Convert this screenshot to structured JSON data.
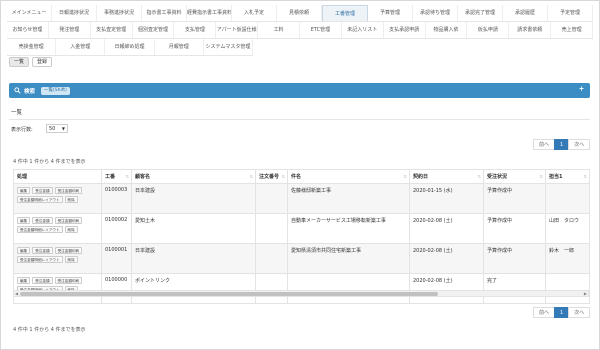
{
  "nav": {
    "row1": [
      "メインメニュー",
      "日報進捗状況",
      "事務進捗状況",
      "指示書工事資料",
      "経費指示書工事資料",
      "入札予定",
      "見積依頼",
      "工番管理",
      "予算管理",
      "承認待ち管理",
      "承認完了管理",
      "承認履歴",
      "予定管理"
    ],
    "row2": [
      "お知らせ管理",
      "発注管理",
      "支払査定管理",
      "個別査定管理",
      "支払管理",
      "アパート仮設仕様",
      "工料",
      "ETC管理",
      "未記入リスト",
      "支払承認申請",
      "物品購入依",
      "仮払申請",
      "請求書依頼",
      "売上管理"
    ],
    "row3": [
      "売掛金管理",
      "入金管理",
      "日報締め処理",
      "月報管理",
      "システムマスタ管理"
    ],
    "active": "工番管理"
  },
  "subtabs": [
    "一覧",
    "登録"
  ],
  "search": {
    "label": "検索",
    "button": "一覧(Shift)"
  },
  "list": {
    "title": "一覧",
    "perpage_label": "表示行数:",
    "perpage_value": "50",
    "info_top": "4 件中 1 件から 4 件までを表示",
    "info_bottom": "4 件中 1 件から 4 件までを表示"
  },
  "pager": {
    "prev": "前へ",
    "current": "1",
    "next": "次へ"
  },
  "table": {
    "headers": [
      "処理",
      "工番",
      "顧客名",
      "注文番号",
      "件名",
      "契約日",
      "受注状況",
      "担当1"
    ],
    "row_buttons": [
      "編集",
      "受注金額",
      "受注金額印刷",
      "受注金額明細レイアウト",
      "削除"
    ],
    "rows": [
      {
        "code": "0100003",
        "customer": "日本建設",
        "order": "",
        "subject": "佐藤様邸新築工事",
        "date": "2020-01-15 (水)",
        "status": "予算作成中",
        "person": ""
      },
      {
        "code": "0100002",
        "customer": "愛知土木",
        "order": "",
        "subject": "自動車メーカーサービス工場移転新築工事",
        "date": "2020-02-08 (土)",
        "status": "予算作成中",
        "person": "山田　タロウ"
      },
      {
        "code": "0100001",
        "customer": "日本建設",
        "order": "",
        "subject": "愛知県清須市共同住宅新築工事",
        "date": "2020-02-08 (土)",
        "status": "予算作成中",
        "person": "鈴木　一郎"
      },
      {
        "code": "0100000",
        "customer": "ポイントリンク",
        "order": "",
        "subject": "",
        "date": "2020-02-08 (土)",
        "status": "完了",
        "person": ""
      }
    ]
  },
  "colors": {
    "accent": "#3b8dc3",
    "pager_active": "#337ab7"
  }
}
